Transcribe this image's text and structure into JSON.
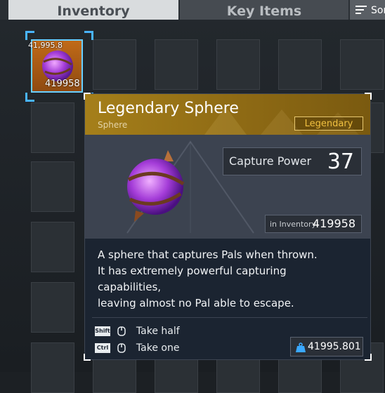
{
  "tabs": {
    "inventory": "Inventory",
    "key_items": "Key Items"
  },
  "sort": {
    "label": "Sor",
    "icon": "sort-icon"
  },
  "selected_slot": {
    "weight": "41,995.8",
    "count": "419958",
    "icon": "legendary-sphere-icon"
  },
  "tooltip": {
    "title": "Legendary Sphere",
    "subtitle": "Sphere",
    "rarity": "Legendary",
    "capture_power_label": "Capture Power",
    "capture_power_value": "37",
    "in_inventory_label": "in Inventory",
    "in_inventory_value": "419958",
    "description": [
      "A sphere that captures Pals when thrown.",
      "It has extremely powerful capturing",
      "capabilities,",
      "leaving almost no Pal able to escape."
    ],
    "hints": [
      {
        "key": "Shift",
        "text": "Take half",
        "icon": "mouse-icon"
      },
      {
        "key": "Ctrl",
        "text": "Take one",
        "icon": "mouse-icon"
      }
    ],
    "total_weight": "41995.801",
    "weight_icon": "weight-icon"
  },
  "colors": {
    "accent": "#49b4ff",
    "rarity_gold": "#f0c040",
    "header_gold": "#a57f1a",
    "slot_orange": "#c06a18"
  }
}
